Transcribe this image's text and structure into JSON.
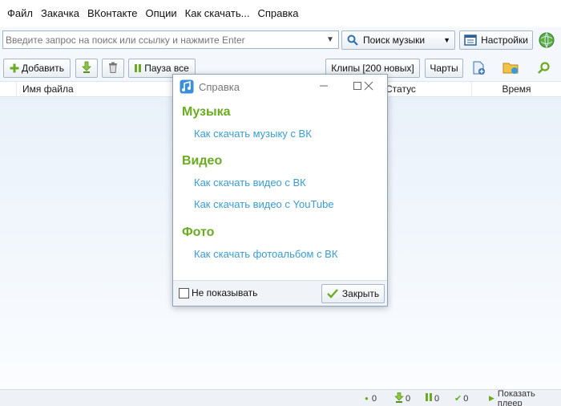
{
  "menu": [
    "Файл",
    "Закачка",
    "ВКонтакте",
    "Опции",
    "Как скачать...",
    "Справка"
  ],
  "search": {
    "placeholder": "Введите запрос на поиск или ссылку и нажмите Enter",
    "type_label": "Поиск музыки",
    "settings_label": "Настройки"
  },
  "toolbar": {
    "add_label": "Добавить",
    "pause_all_label": "Пауза все",
    "clips_label": "Клипы [200 новых]",
    "charts_label": "Чарты"
  },
  "columns": {
    "filename": "Имя файла",
    "status": "Статус",
    "time": "Время"
  },
  "dialog": {
    "title": "Справка",
    "sections": [
      {
        "heading": "Музыка",
        "links": [
          "Как скачать музыку с ВК"
        ]
      },
      {
        "heading": "Видео",
        "links": [
          "Как скачать видео с ВК",
          "Как скачать видео с YouTube"
        ]
      },
      {
        "heading": "Фото",
        "links": [
          "Как скачать фотоальбом с ВК"
        ]
      }
    ],
    "dont_show_label": "Не показывать",
    "close_label": "Закрыть"
  },
  "statusbar": {
    "count_1": "0",
    "count_2": "0",
    "count_3": "0",
    "count_4": "0",
    "player_label": "Показать плеер"
  },
  "icons": {
    "add": "plus-icon",
    "download": "download-arrow-icon",
    "trash": "trash-icon",
    "pause": "pause-icon",
    "settings": "window-settings-icon",
    "globe": "globe-icon"
  },
  "colors": {
    "accent_green": "#6aab22",
    "link_blue": "#3a9cd0"
  }
}
